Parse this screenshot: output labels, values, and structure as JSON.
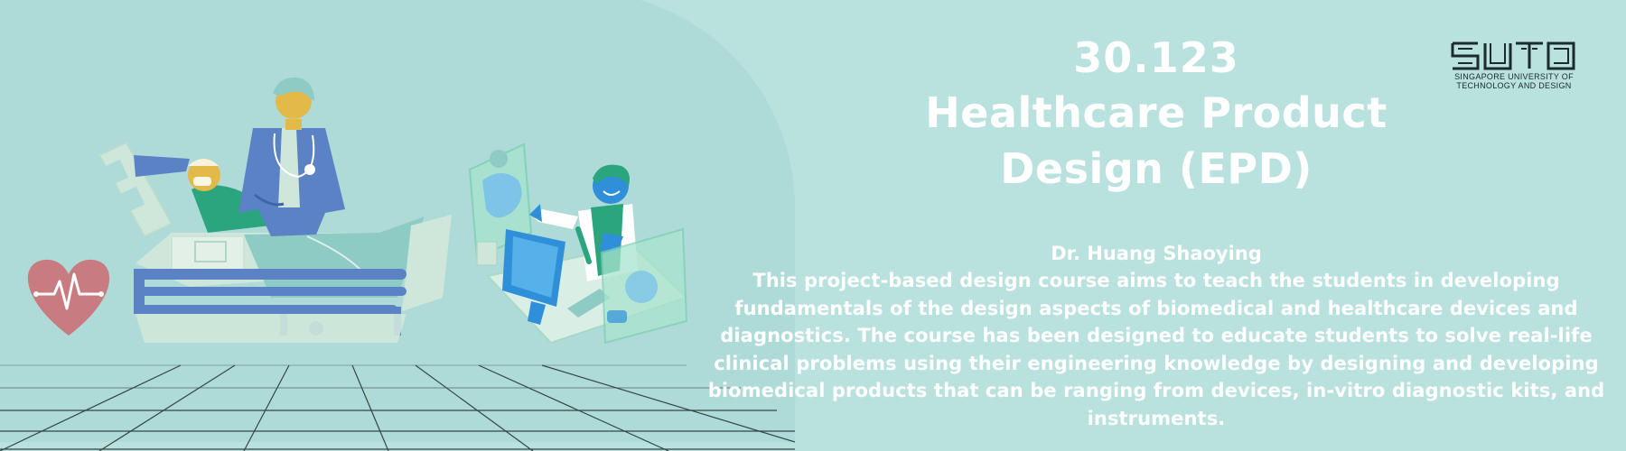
{
  "course": {
    "code": "30.123",
    "title": "Healthcare Product Design (EPD)",
    "instructor": "Dr. Huang Shaoying",
    "description": "This project-based design course aims to teach the students in developing fundamentals of the design aspects of biomedical and healthcare devices and diagnostics. The course has been designed to educate students to solve real-life clinical problems using their engineering knowledge by designing and developing biomedical products that can be ranging from devices, in-vitro diagnostic kits, and instruments."
  },
  "logo": {
    "line1": "SINGAPORE UNIVERSITY OF",
    "line2": "TECHNOLOGY AND DESIGN"
  },
  "icons": [
    "heart-rate-icon",
    "hospital-bed-illustration",
    "doctor-illustration",
    "telemedicine-illustration",
    "sutd-logo-icon"
  ],
  "colors": {
    "background": "#b9e1de",
    "panel": "#aedbd7",
    "text": "#ffffff",
    "heart": "#c97b82",
    "coat_blue": "#5b82c4",
    "screen_blue": "#2f8fd8",
    "patient_green": "#2aa57e",
    "skin_yellow": "#e3b94a"
  }
}
